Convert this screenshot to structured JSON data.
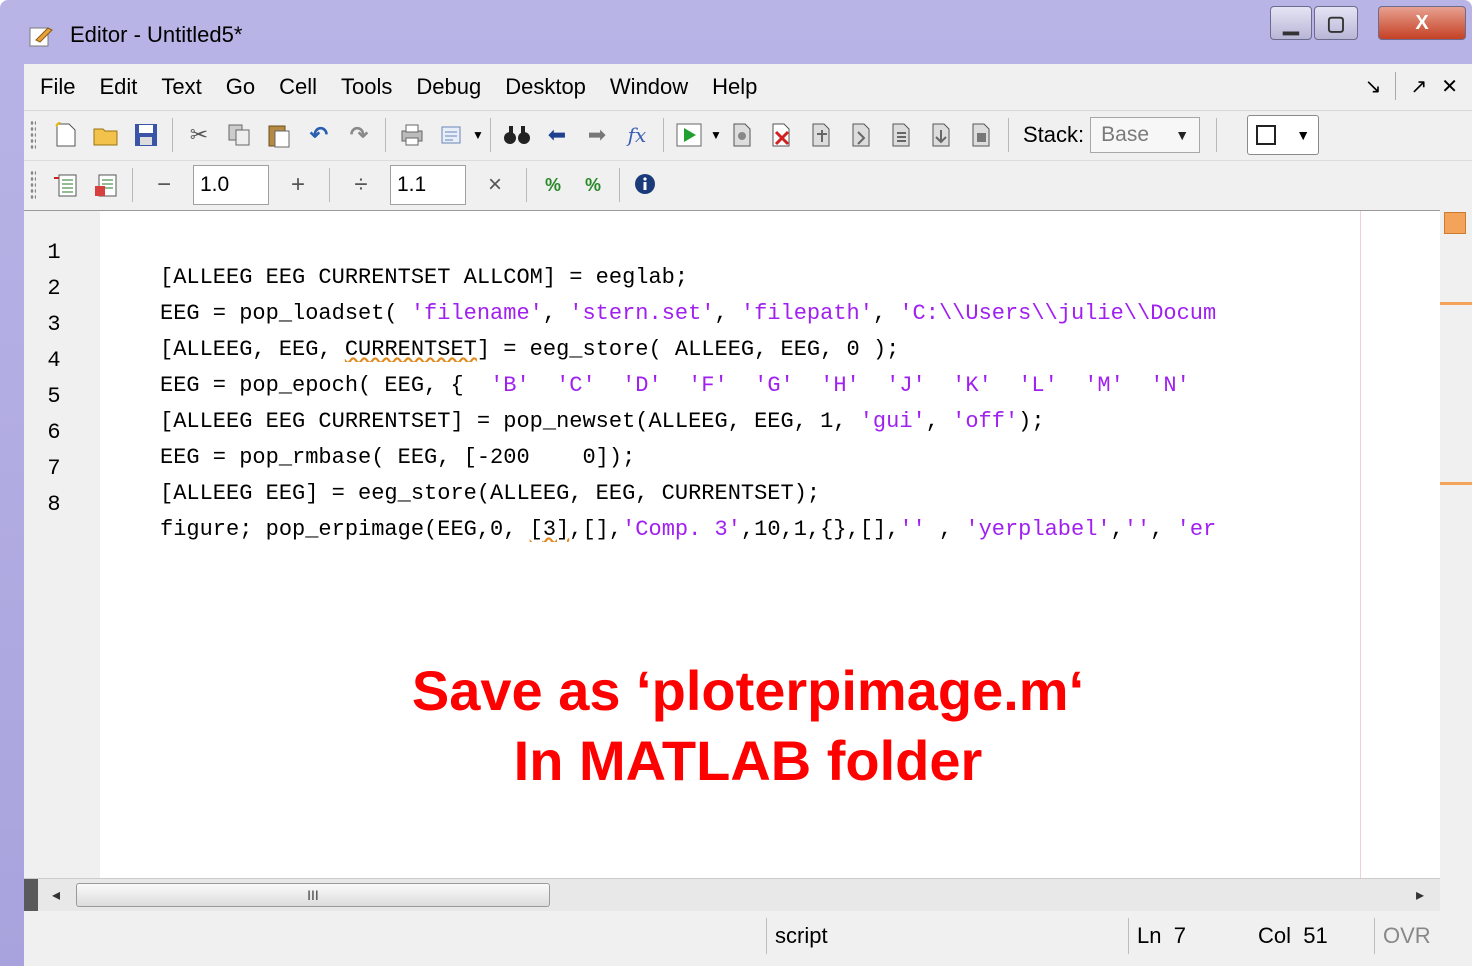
{
  "window": {
    "title": "Editor - Untitled5*",
    "controls": {
      "minimize": "▁",
      "maximize": "▢",
      "close": "X"
    }
  },
  "menubar": {
    "items": [
      "File",
      "Edit",
      "Text",
      "Go",
      "Cell",
      "Tools",
      "Debug",
      "Desktop",
      "Window",
      "Help"
    ],
    "right_icons": [
      "undock-icon",
      "dock-arrow-icon",
      "close-icon"
    ]
  },
  "toolbar": {
    "stack_label": "Stack:",
    "stack_value": "Base"
  },
  "cell_toolbar": {
    "decrement": "−",
    "increment": "+",
    "divide": "÷",
    "multiply": "×",
    "value1": "1.0",
    "value2": "1.1"
  },
  "editor": {
    "line_numbers": [
      "1",
      "2",
      "3",
      "4",
      "5",
      "6",
      "7",
      "8"
    ],
    "lines": [
      "[ALLEEG EEG CURRENTSET ALLCOM] = eeglab;",
      "EEG = pop_loadset( 'filename', 'stern.set', 'filepath', 'C:\\\\Users\\\\julie\\\\Docum",
      "[ALLEEG, EEG, CURRENTSET] = eeg_store( ALLEEG, EEG, 0 );",
      "EEG = pop_epoch( EEG, {  'B'  'C'  'D'  'F'  'G'  'H'  'J'  'K'  'L'  'M'  'N'",
      "[ALLEEG EEG CURRENTSET] = pop_newset(ALLEEG, EEG, 1, 'gui', 'off');",
      "EEG = pop_rmbase( EEG, [-200    0]);",
      "[ALLEEG EEG] = eeg_store(ALLEEG, EEG, CURRENTSET);",
      "figure; pop_erpimage(EEG,0, [3],[],'Comp. 3',10,1,{},[],'' , 'yerplabel','', 'er"
    ]
  },
  "overlay": {
    "line1": "Save as ‘ploterpimage.m‘",
    "line2": "In MATLAB folder"
  },
  "scrollbar": {
    "left": "◂",
    "right": "▸",
    "thumb_grip": "III"
  },
  "statusbar": {
    "mode": "script",
    "ln_label": "Ln",
    "ln_value": "7",
    "col_label": "Col",
    "col_value": "51",
    "ovr": "OVR"
  },
  "colors": {
    "string": "#a020f0",
    "overlay_text": "#ff0000",
    "marker": "#f4a35a",
    "title_bar": "#b8b4e6"
  }
}
